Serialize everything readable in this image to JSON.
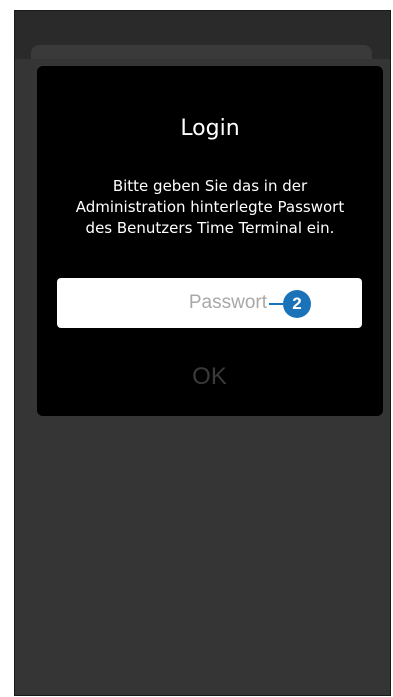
{
  "dialog": {
    "title": "Login",
    "message": "Bitte geben Sie das in der\nAdministration hinterlegte Passwort\ndes Benutzers Time Terminal ein.",
    "password_placeholder": "Passwort",
    "callout_number": "2",
    "ok_label": "OK"
  },
  "colors": {
    "dialog_background": "#000000",
    "overlay_background": "#2a2a2a",
    "callout_accent": "#1a73b8",
    "ok_disabled_text": "#3a3a3a"
  }
}
